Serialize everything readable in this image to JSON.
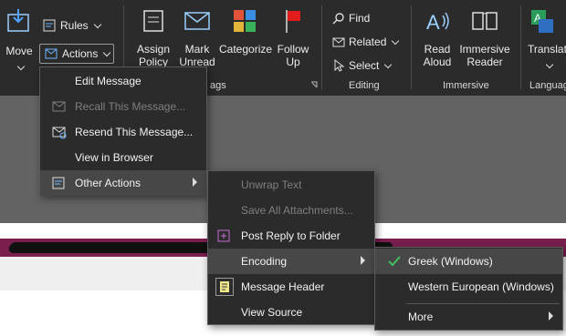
{
  "ribbon": {
    "move_label": "Move",
    "rules_label": "Rules",
    "actions_label": "Actions",
    "assign_policy_line1": "Assign",
    "assign_policy_line2": "Policy",
    "mark_unread_line1": "Mark",
    "mark_unread_line2": "Unread",
    "categorize_label": "Categorize",
    "follow_up_line1": "Follow",
    "follow_up_line2": "Up",
    "tags_group_label": "ags",
    "find_label": "Find",
    "related_label": "Related",
    "select_label": "Select",
    "editing_group_label": "Editing",
    "read_aloud_line1": "Read",
    "read_aloud_line2": "Aloud",
    "immersive_reader_line1": "Immersive",
    "immersive_reader_line2": "Reader",
    "immersive_group_label": "Immersive",
    "translate_label": "Translat",
    "language_group_label": "Languag"
  },
  "actions_menu": {
    "items": [
      {
        "label": "Edit Message",
        "enabled": true
      },
      {
        "label": "Recall This Message...",
        "enabled": false
      },
      {
        "label": "Resend This Message...",
        "enabled": true
      },
      {
        "label": "View in Browser",
        "enabled": true
      },
      {
        "label": "Other Actions",
        "enabled": true,
        "submenu": true
      }
    ]
  },
  "other_actions_menu": {
    "items": [
      {
        "label": "Unwrap Text",
        "enabled": false
      },
      {
        "label": "Save All Attachments...",
        "enabled": false
      },
      {
        "label": "Post Reply to Folder",
        "enabled": true
      },
      {
        "label": "Encoding",
        "enabled": true,
        "submenu": true
      },
      {
        "label": "Message Header",
        "enabled": true
      },
      {
        "label": "View Source",
        "enabled": true
      }
    ]
  },
  "encoding_menu": {
    "items": [
      {
        "label": "Greek (Windows)",
        "checked": true
      },
      {
        "label": "Western European (Windows)",
        "checked": false
      },
      {
        "label": "More",
        "submenu": true
      }
    ]
  },
  "colors": {
    "ribbon_bg": "#2b2b2b",
    "menu_bg": "#2b2b2b",
    "highlight": "#474747",
    "check_green": "#3fbf5f",
    "banner": "#7a1e4e"
  }
}
